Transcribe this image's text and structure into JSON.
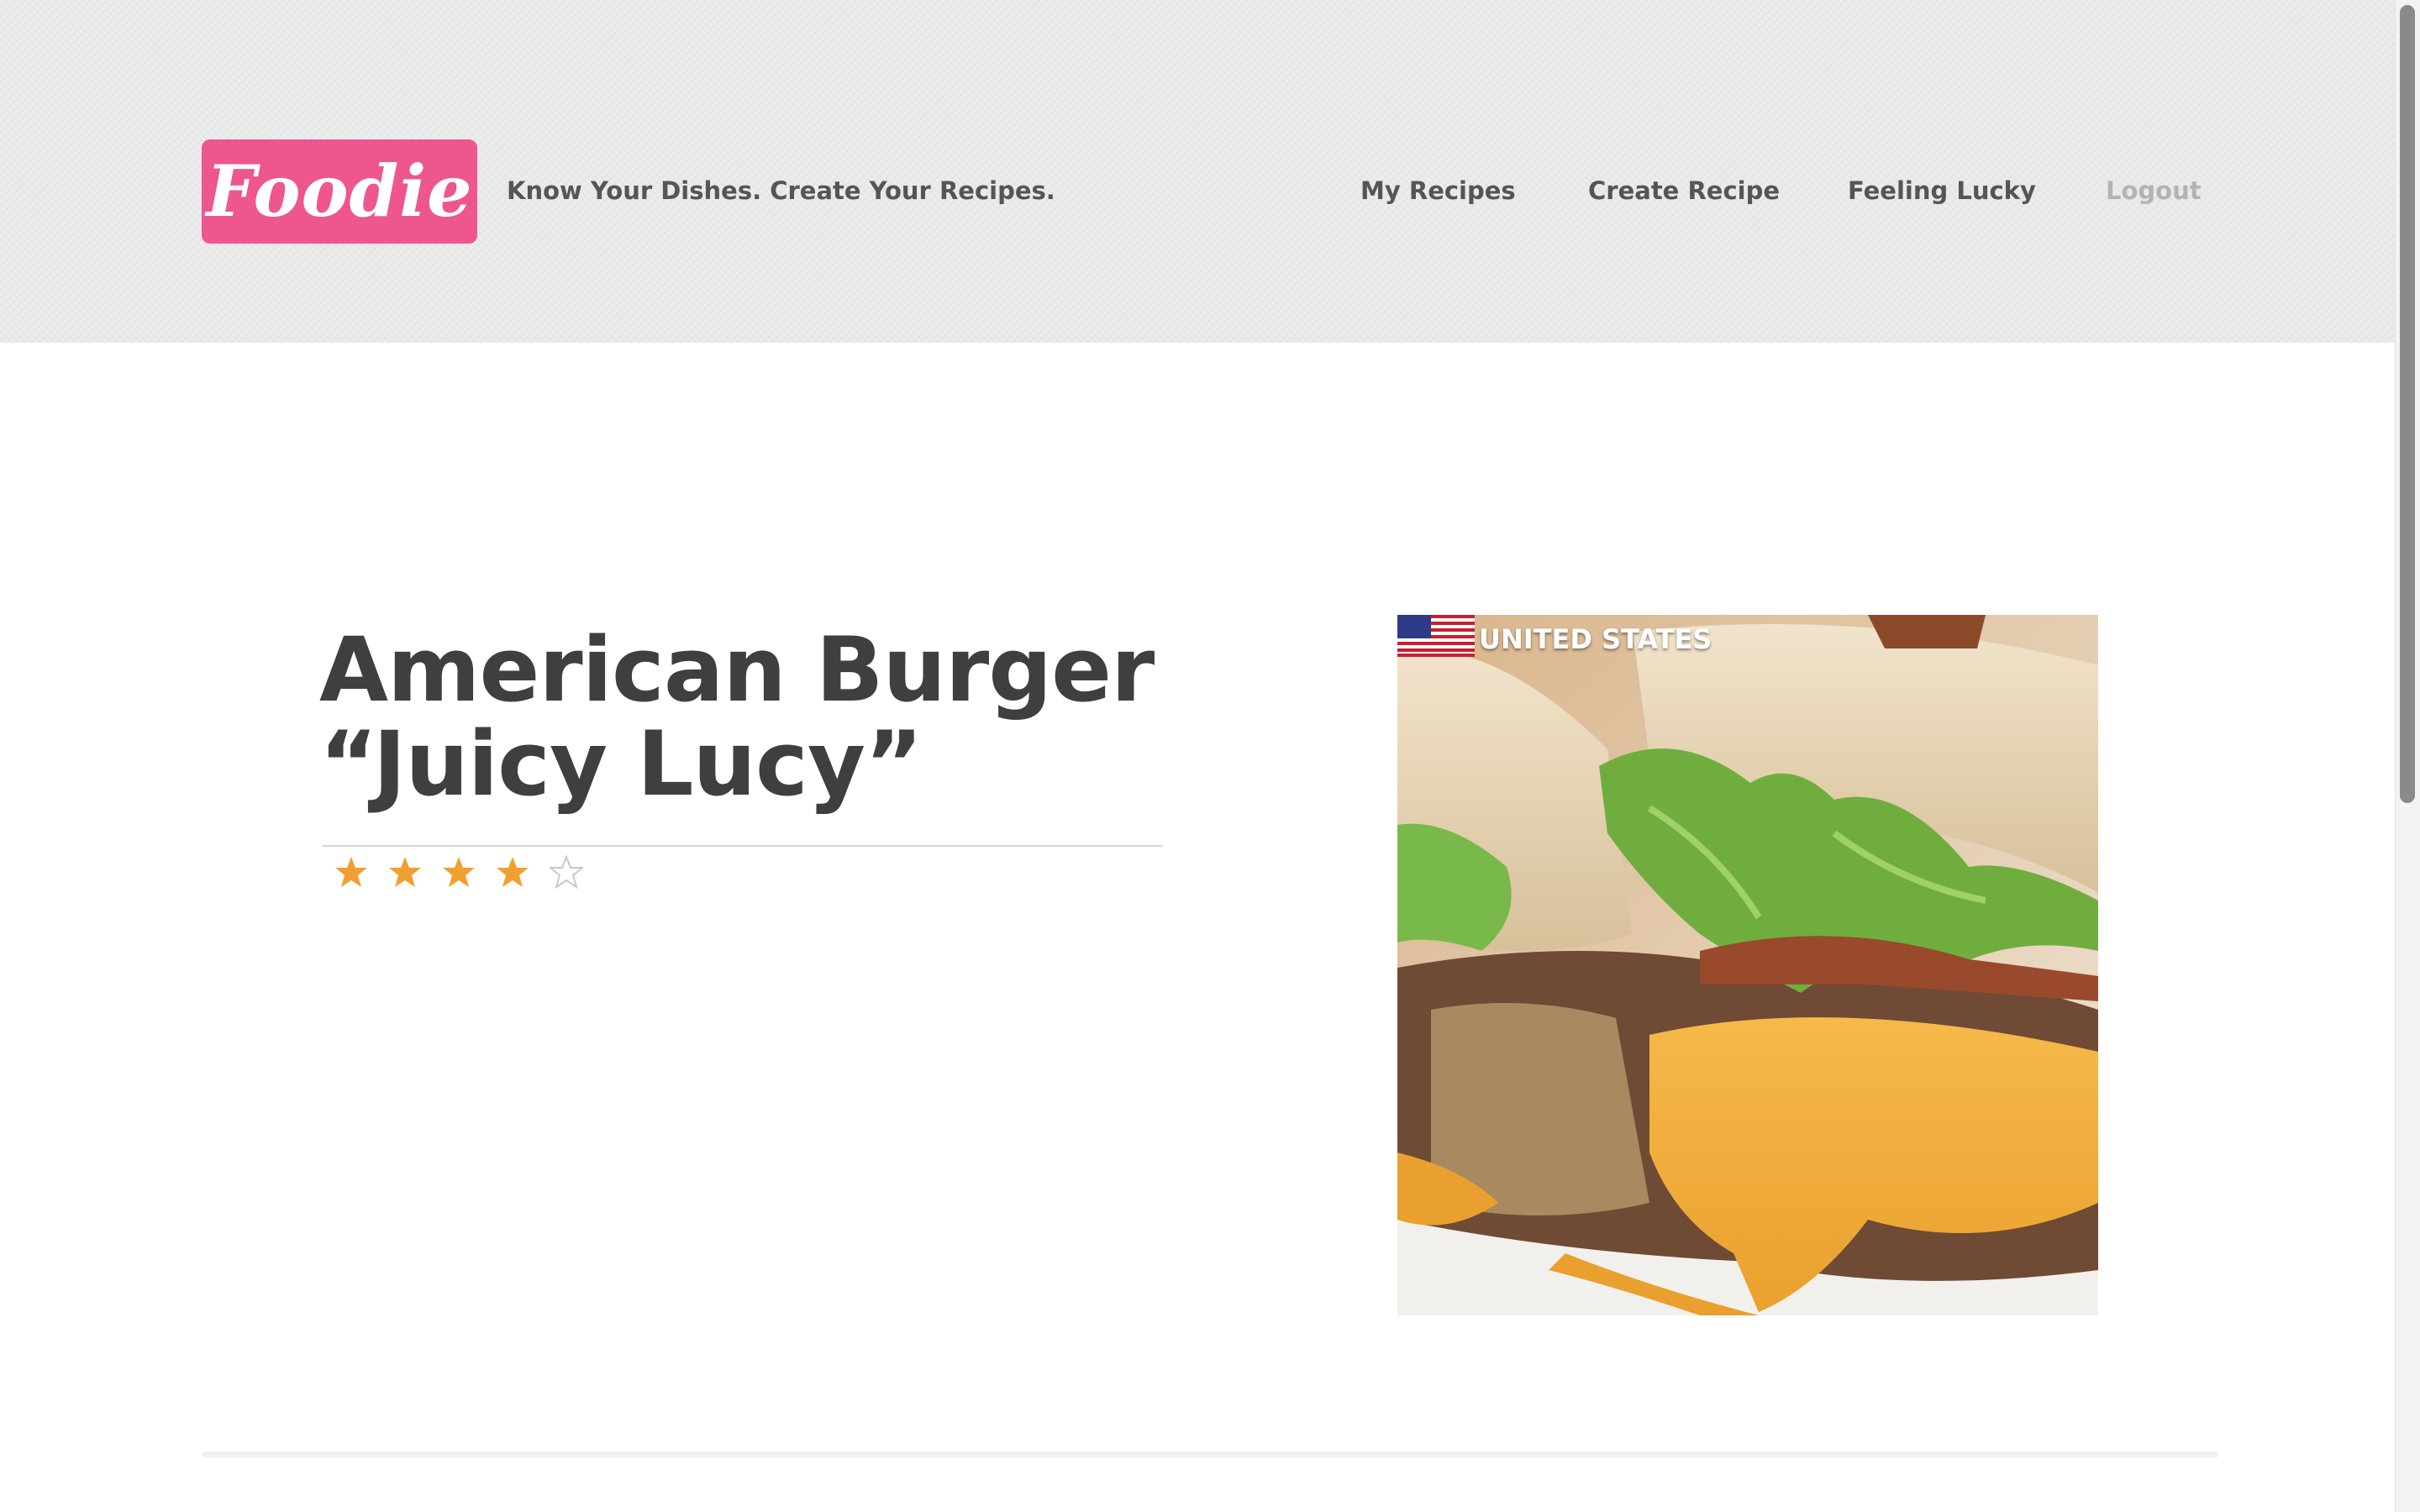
{
  "brand": {
    "logo_text": "Foodie",
    "tagline": "Know Your Dishes. Create Your Recipes.",
    "accent_color": "#ee5690"
  },
  "nav": {
    "my_recipes": "My Recipes",
    "create_recipe": "Create Recipe",
    "feeling_lucky": "Feeling Lucky",
    "logout": "Logout"
  },
  "recipe": {
    "title_line1": "American Burger",
    "title_line2": "“Juicy Lucy”",
    "rating": 4,
    "rating_max": 5,
    "star_color": "#f0a030",
    "image": {
      "caption": "UNITED STATES",
      "flag_icon": "us-flag-icon"
    }
  }
}
